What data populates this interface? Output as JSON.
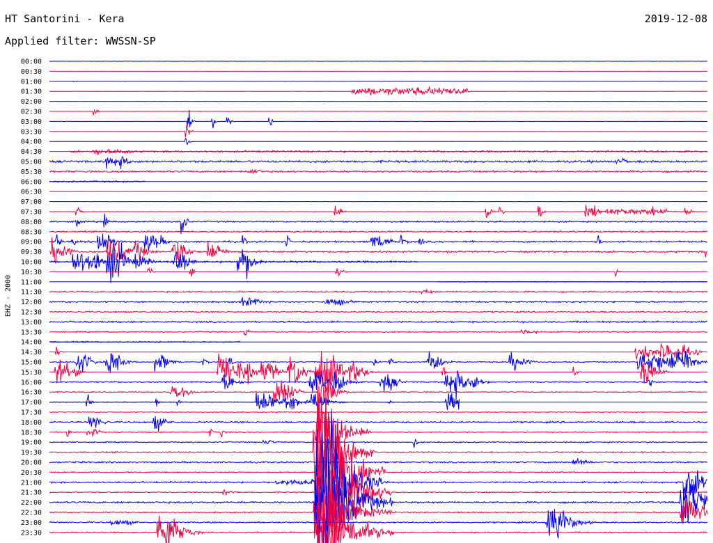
{
  "header": {
    "station": "HT Santorini - Kera",
    "date": "2019-12-08",
    "filter": "Applied filter: WWSSN-SP",
    "channel_label": "EHZ - 2000"
  },
  "colors": {
    "blue_trace": "#0000ee",
    "red_trace": "#f00040"
  },
  "chart_data": {
    "type": "line",
    "title": "HT Santorini - Kera",
    "subtitle": "Applied filter: WWSSN-SP",
    "ylabel": "EHZ - 2000",
    "xlim": [
      0,
      30
    ],
    "xunits": "minutes after row start",
    "colors": [
      "#0000ee",
      "#f00040"
    ],
    "grid": false,
    "series": [
      {
        "label": "00:00",
        "noise": 0.2,
        "events": []
      },
      {
        "label": "00:30",
        "noise": 0.2,
        "events": []
      },
      {
        "label": "01:00",
        "noise": 0.2,
        "events": [
          [
            1.1,
            1,
            0.05,
            0.2
          ]
        ]
      },
      {
        "label": "01:30",
        "noise": 0.2,
        "events": [
          [
            15.5,
            4,
            3.5,
            0.3
          ]
        ]
      },
      {
        "label": "02:00",
        "noise": 0.2,
        "events": []
      },
      {
        "label": "02:30",
        "noise": 0.2,
        "events": [
          [
            2.0,
            5,
            0.05,
            0.3
          ]
        ]
      },
      {
        "label": "03:00",
        "noise": 0.2,
        "events": [
          [
            6.3,
            12,
            0.05,
            0.3
          ],
          [
            7.4,
            10,
            0.05,
            0.3
          ],
          [
            8.1,
            8,
            0.05,
            0.3
          ],
          [
            10.0,
            6,
            0.05,
            0.3
          ]
        ]
      },
      {
        "label": "03:30",
        "noise": 0.2,
        "events": [
          [
            6.2,
            10,
            0.05,
            0.3
          ]
        ]
      },
      {
        "label": "04:00",
        "noise": 0.2,
        "events": [
          [
            6.2,
            8,
            0.05,
            0.3
          ]
        ]
      },
      {
        "label": "04:30",
        "noise": 1.5,
        "start": 0.9,
        "events": [
          [
            2.2,
            3,
            0.5,
            1.5
          ],
          [
            3.0,
            2.5,
            0.5,
            1.5
          ]
        ]
      },
      {
        "label": "05:00",
        "noise": 1.8,
        "events": [
          [
            2.8,
            6,
            0.5,
            1.5
          ],
          [
            26,
            3,
            0.3,
            1
          ]
        ]
      },
      {
        "label": "05:30",
        "noise": 1.5,
        "events": [
          [
            9.2,
            3,
            0.3,
            1
          ]
        ]
      },
      {
        "label": "06:00",
        "noise": 1.3,
        "end": 4.4,
        "events": []
      },
      {
        "label": "06:30",
        "noise": 0.2,
        "events": []
      },
      {
        "label": "07:00",
        "noise": 0.2,
        "events": []
      },
      {
        "label": "07:30",
        "noise": 0.3,
        "events": [
          [
            1.2,
            6,
            0.05,
            0.4
          ],
          [
            13.0,
            10,
            0.05,
            0.5
          ],
          [
            19.9,
            10,
            0.05,
            0.4
          ],
          [
            20.5,
            8,
            0.05,
            0.3
          ],
          [
            22.3,
            12,
            0.05,
            0.3
          ],
          [
            24.6,
            6,
            0.4,
            1.5
          ],
          [
            26.0,
            3,
            2,
            1
          ],
          [
            27.5,
            6,
            0.05,
            0.3
          ],
          [
            29,
            5,
            0.1,
            0.5
          ]
        ]
      },
      {
        "label": "08:00",
        "noise": 1.2,
        "events": [
          [
            1.2,
            12,
            0.05,
            0.3
          ],
          [
            2.5,
            10,
            0.05,
            0.3
          ],
          [
            6.0,
            22,
            0.05,
            0.4
          ]
        ]
      },
      {
        "label": "08:30",
        "noise": 1.3,
        "events": []
      },
      {
        "label": "09:00",
        "noise": 1.4,
        "events": [
          [
            0.3,
            10,
            0.05,
            0.3
          ],
          [
            1.0,
            9,
            0.05,
            0.3
          ],
          [
            2.3,
            12,
            0.3,
            1
          ],
          [
            4.5,
            9,
            0.4,
            1
          ],
          [
            8.8,
            8,
            0.05,
            0.3
          ],
          [
            10.8,
            8,
            0.05,
            0.3
          ],
          [
            14.8,
            7,
            0.4,
            1.2
          ],
          [
            16.0,
            6,
            0.1,
            0.5
          ],
          [
            16.8,
            5,
            0.1,
            0.5
          ],
          [
            25.0,
            10,
            0.05,
            0.3
          ],
          [
            30.0,
            12,
            0.05,
            0.3
          ],
          [
            31.4,
            14,
            0.05,
            0.3
          ],
          [
            32.2,
            12,
            0.05,
            0.3
          ]
        ]
      },
      {
        "label": "09:30",
        "noise": 1.5,
        "events": [
          [
            0.2,
            14,
            0.3,
            1
          ],
          [
            2.8,
            14,
            0.4,
            1.2
          ],
          [
            3.9,
            10,
            0.2,
            1
          ],
          [
            5.7,
            12,
            0.3,
            1
          ],
          [
            7.3,
            10,
            0.3,
            1
          ],
          [
            29.9,
            10,
            0.05,
            0.3
          ]
        ]
      },
      {
        "label": "10:00",
        "noise": 1.5,
        "end": 16.8,
        "events": [
          [
            1.2,
            12,
            0.3,
            1
          ],
          [
            1.9,
            10,
            0.3,
            1
          ],
          [
            2.8,
            20,
            0.4,
            1
          ],
          [
            4.0,
            8,
            0.2,
            1
          ],
          [
            5.8,
            10,
            0.3,
            1
          ],
          [
            8.7,
            16,
            0.3,
            1
          ],
          [
            17.2,
            16,
            0.05,
            0.3
          ],
          [
            27.8,
            3,
            0.2,
            1
          ]
        ]
      },
      {
        "label": "10:30",
        "noise": 0.2,
        "events": [
          [
            4.5,
            6,
            0.05,
            0.3
          ],
          [
            6.4,
            8,
            0.05,
            0.3
          ],
          [
            13.1,
            5,
            0.1,
            0.5
          ],
          [
            25.8,
            5,
            0.05,
            0.3
          ]
        ]
      },
      {
        "label": "11:00",
        "noise": 0.6,
        "start": 17.7,
        "events": []
      },
      {
        "label": "11:30",
        "noise": 1.2,
        "events": [
          [
            17.0,
            3,
            0.2,
            1
          ]
        ]
      },
      {
        "label": "12:00",
        "noise": 1.3,
        "events": [
          [
            8.9,
            4,
            0.5,
            1.5
          ],
          [
            12.8,
            3.5,
            0.5,
            1.5
          ]
        ]
      },
      {
        "label": "12:30",
        "noise": 1.1,
        "events": []
      },
      {
        "label": "13:00",
        "noise": 1.4,
        "events": []
      },
      {
        "label": "13:30",
        "noise": 1.0,
        "events": [
          [
            8.9,
            8,
            0.05,
            0.3
          ],
          [
            21.6,
            3,
            0.3,
            1
          ]
        ]
      },
      {
        "label": "14:00",
        "noise": 1.1,
        "end": 8.7,
        "events": [
          [
            8.7,
            10,
            0.05,
            0.3
          ],
          [
            17.5,
            6,
            0.05,
            0.3
          ],
          [
            27.9,
            8,
            0.05,
            0.3
          ],
          [
            29.2,
            6,
            0.05,
            0.3
          ]
        ]
      },
      {
        "label": "14:30",
        "noise": 0.2,
        "events": [
          [
            0.3,
            6,
            0.05,
            0.3
          ],
          [
            26.9,
            8,
            0.4,
            1
          ],
          [
            28.0,
            10,
            0.3,
            1
          ],
          [
            28.6,
            8,
            0.3,
            1
          ],
          [
            29.5,
            6,
            0.05,
            0.3
          ]
        ]
      },
      {
        "label": "15:00",
        "noise": 0.9,
        "events": [
          [
            1.3,
            10,
            0.3,
            1
          ],
          [
            2.7,
            12,
            0.3,
            1
          ],
          [
            4.9,
            10,
            0.2,
            1
          ],
          [
            7.0,
            8,
            0.05,
            0.3
          ],
          [
            8.2,
            6,
            0.05,
            0.3
          ],
          [
            14.8,
            6,
            0.1,
            0.3
          ],
          [
            15.5,
            8,
            0.05,
            0.3
          ],
          [
            17.3,
            10,
            0.3,
            1
          ],
          [
            21.1,
            10,
            0.3,
            1
          ],
          [
            26.9,
            10,
            0.2,
            1
          ],
          [
            27.5,
            12,
            0.3,
            1
          ],
          [
            28.4,
            12,
            0.4,
            1
          ],
          [
            28.8,
            14,
            0.3,
            1
          ]
        ]
      },
      {
        "label": "15:30",
        "noise": 0.3,
        "events": [
          [
            0.4,
            12,
            0.3,
            1
          ],
          [
            1.2,
            10,
            0.05,
            0.3
          ],
          [
            7.8,
            16,
            0.3,
            1
          ],
          [
            8.7,
            12,
            0.3,
            1
          ],
          [
            9.8,
            12,
            0.3,
            1
          ],
          [
            11.0,
            16,
            0.3,
            1
          ],
          [
            12.4,
            20,
            0.6,
            1
          ],
          [
            13.0,
            10,
            0.3,
            1
          ],
          [
            13.8,
            10,
            0.3,
            1
          ],
          [
            17.9,
            10,
            0.05,
            0.3
          ],
          [
            23.9,
            6,
            0.05,
            0.3
          ],
          [
            27.1,
            12,
            0.3,
            1
          ]
        ]
      },
      {
        "label": "16:00",
        "noise": 1.0,
        "events": [
          [
            8.0,
            8,
            0.3,
            1
          ],
          [
            12.0,
            12,
            0.3,
            1
          ],
          [
            13.0,
            10,
            0.3,
            1
          ],
          [
            15.2,
            10,
            0.3,
            1
          ],
          [
            18.2,
            14,
            0.4,
            1
          ],
          [
            19.0,
            10,
            0.3,
            1
          ],
          [
            27.3,
            8,
            0.05,
            0.3
          ],
          [
            29.8,
            6,
            0.05,
            0.3
          ]
        ]
      },
      {
        "label": "16:30",
        "noise": 0.9,
        "events": [
          [
            5.6,
            8,
            0.2,
            1
          ],
          [
            5.8,
            8,
            0.2,
            1
          ],
          [
            10.4,
            14,
            0.4,
            1
          ],
          [
            12.4,
            14,
            0.4,
            1
          ]
        ]
      },
      {
        "label": "17:00",
        "noise": 0.7,
        "end": 18.7,
        "events": [
          [
            1.7,
            10,
            0.05,
            0.3
          ],
          [
            4.8,
            6,
            0.05,
            0.3
          ],
          [
            5.8,
            6,
            0.05,
            0.3
          ],
          [
            9.6,
            12,
            0.4,
            1
          ],
          [
            10.8,
            10,
            0.3,
            1
          ],
          [
            12.1,
            10,
            0.4,
            1
          ],
          [
            15.4,
            4,
            0.05,
            0.3
          ],
          [
            18.2,
            10,
            0.3,
            1
          ],
          [
            19.3,
            10,
            0.05,
            0.3
          ]
        ]
      },
      {
        "label": "17:30",
        "noise": 0.7,
        "events": []
      },
      {
        "label": "18:00",
        "noise": 1.4,
        "events": [
          [
            1.9,
            8,
            0.2,
            1
          ],
          [
            4.8,
            8,
            0.2,
            1
          ]
        ]
      },
      {
        "label": "18:30",
        "noise": 0.9,
        "events": [
          [
            0.8,
            6,
            0.05,
            0.3
          ],
          [
            1.7,
            6,
            0.05,
            0.3
          ],
          [
            2.0,
            5,
            0.1,
            0.5
          ],
          [
            7.3,
            6,
            0.05,
            0.3
          ],
          [
            7.8,
            6,
            0.05,
            0.3
          ],
          [
            13.7,
            3,
            0.3,
            1
          ],
          [
            12.3,
            40,
            0.4,
            2
          ]
        ]
      },
      {
        "label": "19:00",
        "noise": 1.0,
        "events": [
          [
            9.8,
            3,
            0.2,
            1
          ],
          [
            16.6,
            8,
            0.05,
            0.3
          ]
        ]
      },
      {
        "label": "19:30",
        "noise": 1.1,
        "events": [
          [
            12.2,
            60,
            0.4,
            2.2
          ]
        ]
      },
      {
        "label": "20:00",
        "noise": 1.3,
        "events": [
          [
            24.0,
            4,
            0.3,
            1
          ]
        ]
      },
      {
        "label": "20:30",
        "noise": 1.0,
        "events": [
          [
            12.4,
            90,
            0.4,
            2.5
          ]
        ]
      },
      {
        "label": "21:00",
        "noise": 1.3,
        "events": [
          [
            11.0,
            3,
            1.4,
            0.6
          ],
          [
            12.3,
            80,
            0.4,
            2.5
          ],
          [
            29.0,
            30,
            0.2,
            1.4
          ]
        ]
      },
      {
        "label": "21:30",
        "noise": 1.0,
        "events": [
          [
            12.3,
            70,
            0.3,
            3
          ],
          [
            8.0,
            3,
            0.2,
            1
          ]
        ]
      },
      {
        "label": "22:00",
        "noise": 1.5,
        "events": [
          [
            12.3,
            60,
            0.4,
            3
          ],
          [
            28.9,
            26,
            0.3,
            2.2
          ]
        ]
      },
      {
        "label": "22:30",
        "noise": 1.0,
        "events": [
          [
            12.3,
            30,
            0.5,
            3
          ],
          [
            28.9,
            18,
            0.3,
            2
          ]
        ]
      },
      {
        "label": "23:00",
        "noise": 1.2,
        "events": [
          [
            3.0,
            3,
            0.5,
            1.5
          ],
          [
            22.8,
            20,
            0.4,
            1.6
          ],
          [
            23.1,
            10,
            0.05,
            0.3
          ]
        ]
      },
      {
        "label": "23:30",
        "noise": 1.0,
        "events": [
          [
            5.1,
            22,
            0.4,
            1.5
          ],
          [
            12.3,
            50,
            0.4,
            3
          ]
        ]
      }
    ]
  }
}
